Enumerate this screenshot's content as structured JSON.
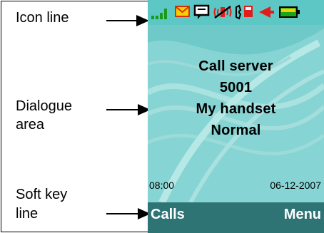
{
  "annotations": {
    "icon_line": "Icon line",
    "dialogue_area_line1": "Dialogue",
    "dialogue_area_line2": "area",
    "soft_key_line1": "Soft key",
    "soft_key_line2": "line"
  },
  "status_icons": [
    "signal-bars-icon",
    "envelope-icon",
    "message-icon",
    "vibrate-icon",
    "phone-icon",
    "speaker-icon",
    "battery-icon"
  ],
  "dialogue": {
    "line1": "Call server",
    "line2": "5001",
    "line3": "My handset",
    "line4": "Normal"
  },
  "status_line": {
    "time": "08:00",
    "date": "06-12-2007"
  },
  "soft_keys": {
    "left": "Calls",
    "right": "Menu"
  },
  "colors": {
    "screen_bg": "#7fd0d0",
    "softkey_bar": "#2f7475",
    "signal": "#1a9a1a",
    "envelope": "#f5a400",
    "red_icons": "#e21c1c",
    "battery": "#1aa51a"
  }
}
